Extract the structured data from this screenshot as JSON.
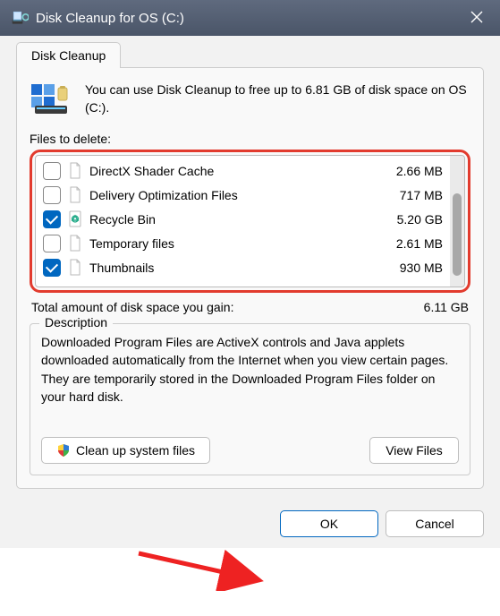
{
  "titlebar": {
    "title": "Disk Cleanup for OS (C:)"
  },
  "tab": {
    "label": "Disk Cleanup"
  },
  "intro": {
    "text": "You can use Disk Cleanup to free up to 6.81 GB of disk space on OS (C:)."
  },
  "files_label": "Files to delete:",
  "list": {
    "items": [
      {
        "label": "DirectX Shader Cache",
        "size": "2.66 MB",
        "checked": false,
        "icon": "doc"
      },
      {
        "label": "Delivery Optimization Files",
        "size": "717 MB",
        "checked": false,
        "icon": "doc"
      },
      {
        "label": "Recycle Bin",
        "size": "5.20 GB",
        "checked": true,
        "icon": "recycle"
      },
      {
        "label": "Temporary files",
        "size": "2.61 MB",
        "checked": false,
        "icon": "doc"
      },
      {
        "label": "Thumbnails",
        "size": "930 MB",
        "checked": true,
        "icon": "doc"
      }
    ]
  },
  "total": {
    "label": "Total amount of disk space you gain:",
    "size": "6.11 GB"
  },
  "description": {
    "legend": "Description",
    "text": "Downloaded Program Files are ActiveX controls and Java applets downloaded automatically from the Internet when you view certain pages. They are temporarily stored in the Downloaded Program Files folder on your hard disk."
  },
  "buttons": {
    "clean_system": "Clean up system files",
    "view_files": "View Files",
    "ok": "OK",
    "cancel": "Cancel"
  }
}
